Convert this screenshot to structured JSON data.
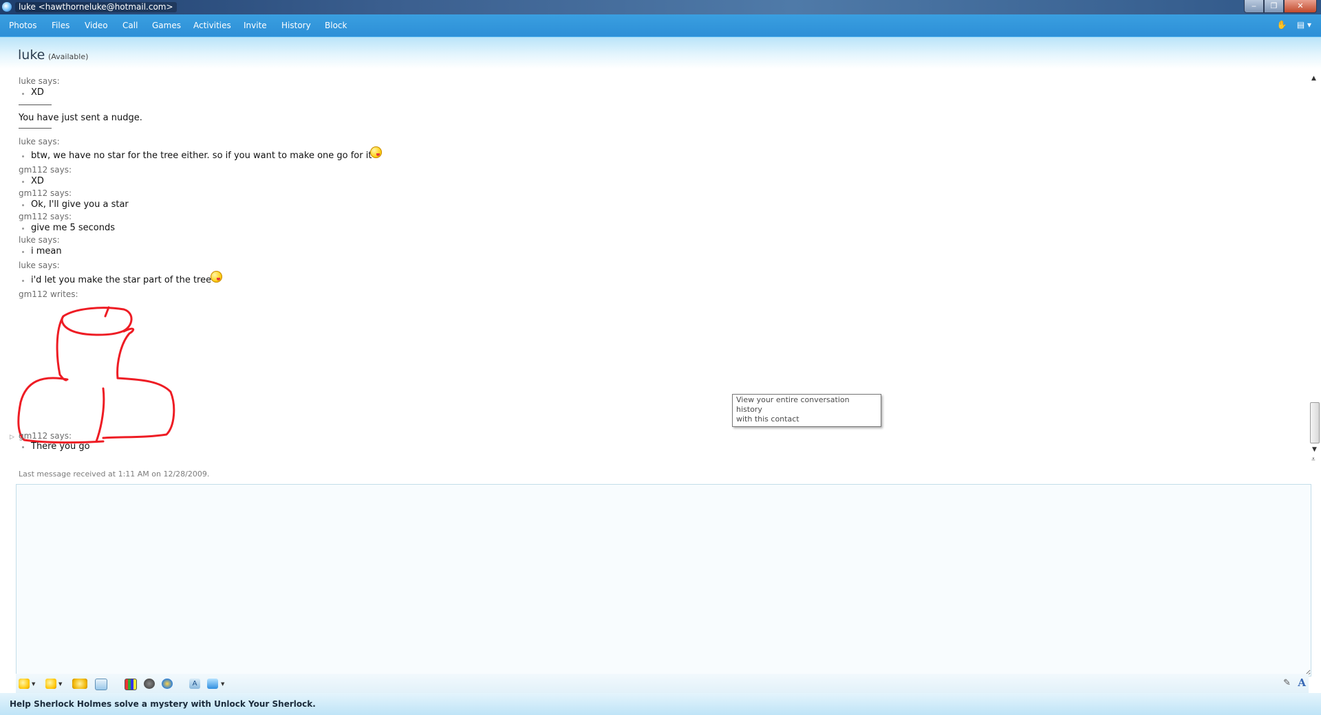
{
  "window": {
    "title": "luke <hawthorneluke@hotmail.com>",
    "controls": [
      "minimize",
      "maximize",
      "close"
    ]
  },
  "menu": {
    "items": [
      "Photos",
      "Files",
      "Video",
      "Call",
      "Games",
      "Activities",
      "Invite",
      "History",
      "Block"
    ],
    "right_icons": [
      "winks-icon",
      "options-menu-icon"
    ]
  },
  "header": {
    "contact_name": "luke",
    "status": "(Available)"
  },
  "conversation": {
    "entries": [
      {
        "sender": "luke says:",
        "text": "XD"
      },
      {
        "system": "You have just sent a nudge."
      },
      {
        "sender": "luke says:",
        "text": "btw, we have no star for the tree either. so if you want to make one go for it",
        "emoticon": "tongue-out"
      },
      {
        "sender": "gm112 says:",
        "text": "XD"
      },
      {
        "sender": "gm112 says:",
        "text": "Ok, I'll give you a star"
      },
      {
        "sender": "gm112 says:",
        "text": "give me 5 seconds"
      },
      {
        "sender": "luke says:",
        "text": "i mean"
      },
      {
        "sender": "luke says:",
        "text": "i'd let you make the star part of the tree",
        "emoticon": "tongue-out"
      },
      {
        "sender": "gm112 writes:",
        "ink": true
      },
      {
        "sender": "gm112 says:",
        "text": "There you go"
      }
    ],
    "last_received": "Last message received at 1:11 AM on 12/28/2009.",
    "ink_color": "#ee1c24"
  },
  "tooltip": {
    "line1": "View your entire conversation history",
    "line2": "with this contact"
  },
  "compose": {
    "value": "",
    "toolbar": [
      "emoticon-icon",
      "wink-icon",
      "nudge-icon",
      "voice-clip-icon",
      "background-icon",
      "games-icon",
      "activities-icon",
      "font-icon",
      "picture-icon",
      "handwriting-icon",
      "text-format-icon"
    ]
  },
  "footer": {
    "ad_text": "Help Sherlock Holmes solve a mystery with Unlock Your Sherlock."
  },
  "colors": {
    "menubar": "#2d8fd7",
    "titlebar": "#2f5687",
    "ink": "#ee1c24"
  }
}
